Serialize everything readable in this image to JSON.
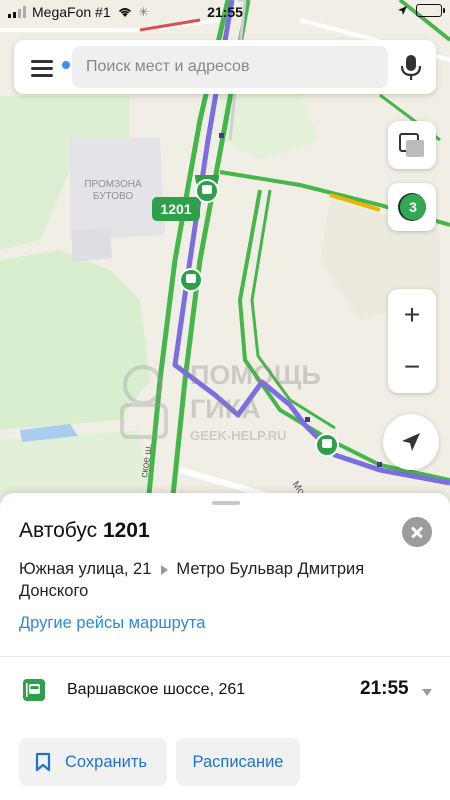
{
  "status_bar": {
    "carrier": "MegaFon #1",
    "time": "21:55"
  },
  "search": {
    "placeholder": "Поиск мест и адресов"
  },
  "map": {
    "area_label_line1": "ПРОМЗОНА",
    "area_label_line2": "БУТОВО",
    "route_number": "1201",
    "traffic_level": "3",
    "road_label_1": "ское ш.",
    "road_label_2": "Моло",
    "route_color": "#7a6ee0",
    "road_green": "#45b64a",
    "traffic_badge_color": "#33a852"
  },
  "watermark": {
    "line1": "ПОМОЩЬ",
    "line2": "ГИКА",
    "line3": "GEEK-HELP.RU"
  },
  "sheet": {
    "type_label": "Автобус",
    "route_number": "1201",
    "from_stop": "Южная улица, 21",
    "to_stop": "Метро Бульвар Дмитрия Донского",
    "other_routes_link": "Другие рейсы маршрута",
    "stop": {
      "name": "Варшавское шоссе, 261",
      "time": "21:55"
    },
    "save_label": "Сохранить",
    "schedule_label": "Расписание"
  },
  "icons": {
    "menu": "hamburger-menu-icon",
    "mic": "microphone-icon",
    "layers": "layers-icon",
    "traffic": "traffic-icon",
    "locate": "navigation-arrow-icon",
    "close": "close-icon",
    "bookmark": "bookmark-icon",
    "bus_stop": "bus-stop-icon"
  }
}
